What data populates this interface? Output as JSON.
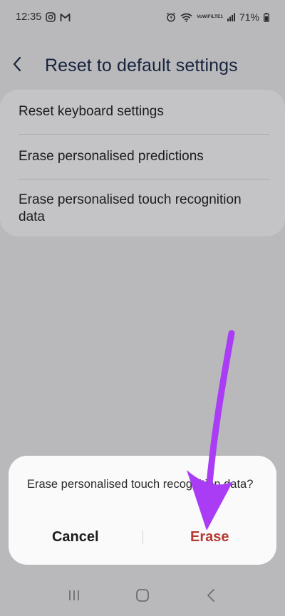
{
  "status_bar": {
    "time": "12:35",
    "network_label_top": "VoWiFi",
    "network_label_bottom": "LTE1",
    "battery": "71%"
  },
  "header": {
    "title": "Reset to default settings"
  },
  "settings": {
    "items": [
      {
        "label": "Reset keyboard settings"
      },
      {
        "label": "Erase personalised predictions"
      },
      {
        "label": "Erase personalised touch recognition data"
      }
    ]
  },
  "dialog": {
    "message": "Erase personalised touch recognition data?",
    "cancel_label": "Cancel",
    "erase_label": "Erase"
  },
  "colors": {
    "background": "#b9b9bc",
    "card": "#c4c4c7",
    "dialog": "#fafafa",
    "title": "#17233c",
    "erase": "#b53a33",
    "annotation_arrow": "#a93cf4"
  },
  "icons": {
    "status": [
      "instagram-icon",
      "gmail-icon",
      "alarm-icon",
      "wifi-icon",
      "signal-icon",
      "battery-icon"
    ],
    "header": "chevron-left-icon",
    "nav": [
      "recents-icon",
      "home-icon",
      "back-icon"
    ]
  }
}
